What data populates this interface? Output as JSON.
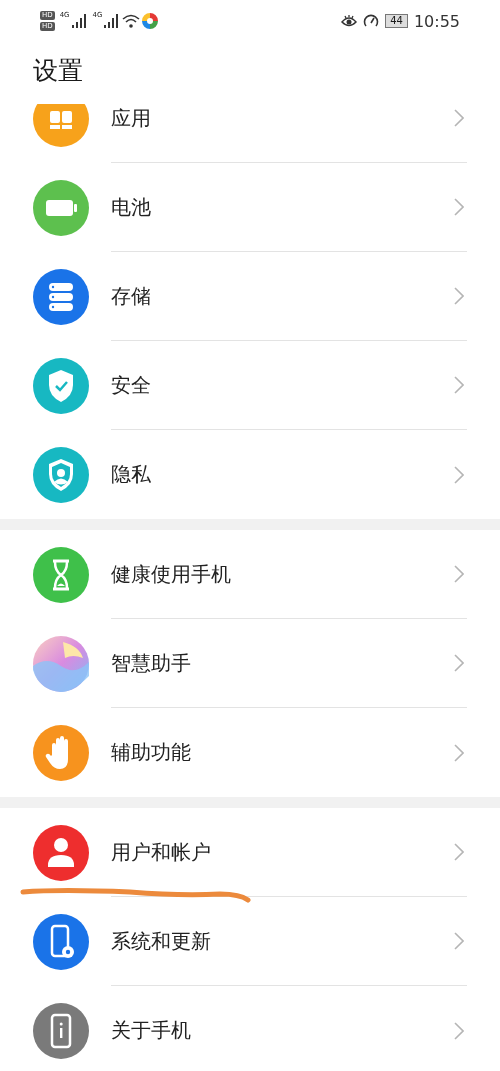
{
  "status_bar": {
    "sims": [
      {
        "hd": "HD",
        "network": "4G"
      },
      {
        "hd": "HD",
        "network": "4G"
      }
    ],
    "battery": "44",
    "time": "10:55"
  },
  "title": "设置",
  "groups": [
    {
      "items": [
        {
          "kind": "apps",
          "label": "应用",
          "underlined": false
        },
        {
          "kind": "battery",
          "label": "电池",
          "underlined": false
        },
        {
          "kind": "storage",
          "label": "存储",
          "underlined": false
        },
        {
          "kind": "security",
          "label": "安全",
          "underlined": false
        },
        {
          "kind": "privacy",
          "label": "隐私",
          "underlined": false
        }
      ]
    },
    {
      "items": [
        {
          "kind": "hourglass",
          "label": "健康使用手机",
          "underlined": false
        },
        {
          "kind": "assistant",
          "label": "智慧助手",
          "underlined": false
        },
        {
          "kind": "hand",
          "label": "辅助功能",
          "underlined": false
        }
      ]
    },
    {
      "items": [
        {
          "kind": "user",
          "label": "用户和帐户",
          "underlined": true
        },
        {
          "kind": "system",
          "label": "系统和更新",
          "underlined": false
        },
        {
          "kind": "about",
          "label": "关于手机",
          "underlined": false
        }
      ]
    }
  ]
}
